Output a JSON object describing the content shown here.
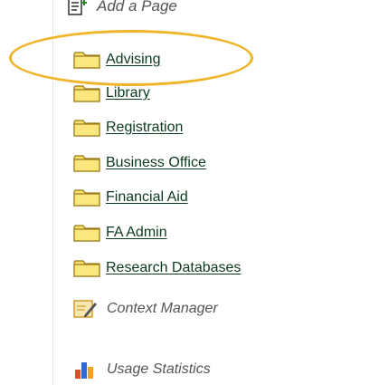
{
  "sidebar": {
    "add_page_label": "Add a Page",
    "folders": [
      {
        "label": "Advising"
      },
      {
        "label": "Library"
      },
      {
        "label": "Registration"
      },
      {
        "label": "Business Office"
      },
      {
        "label": "Financial Aid"
      },
      {
        "label": "FA Admin"
      },
      {
        "label": "Research Databases"
      }
    ],
    "context_manager_label": "Context Manager",
    "usage_statistics_label": "Usage Statistics"
  },
  "colors": {
    "folder_fill": "#f6df6a",
    "folder_border": "#9a7a16",
    "link_text": "#0b3a1f",
    "highlight": "#f0b429",
    "muted_text": "#555555"
  },
  "icons": {
    "add_page": "add-page-icon",
    "folder": "folder-icon",
    "context_manager": "pencil-note-icon",
    "usage_statistics": "bar-chart-icon"
  }
}
